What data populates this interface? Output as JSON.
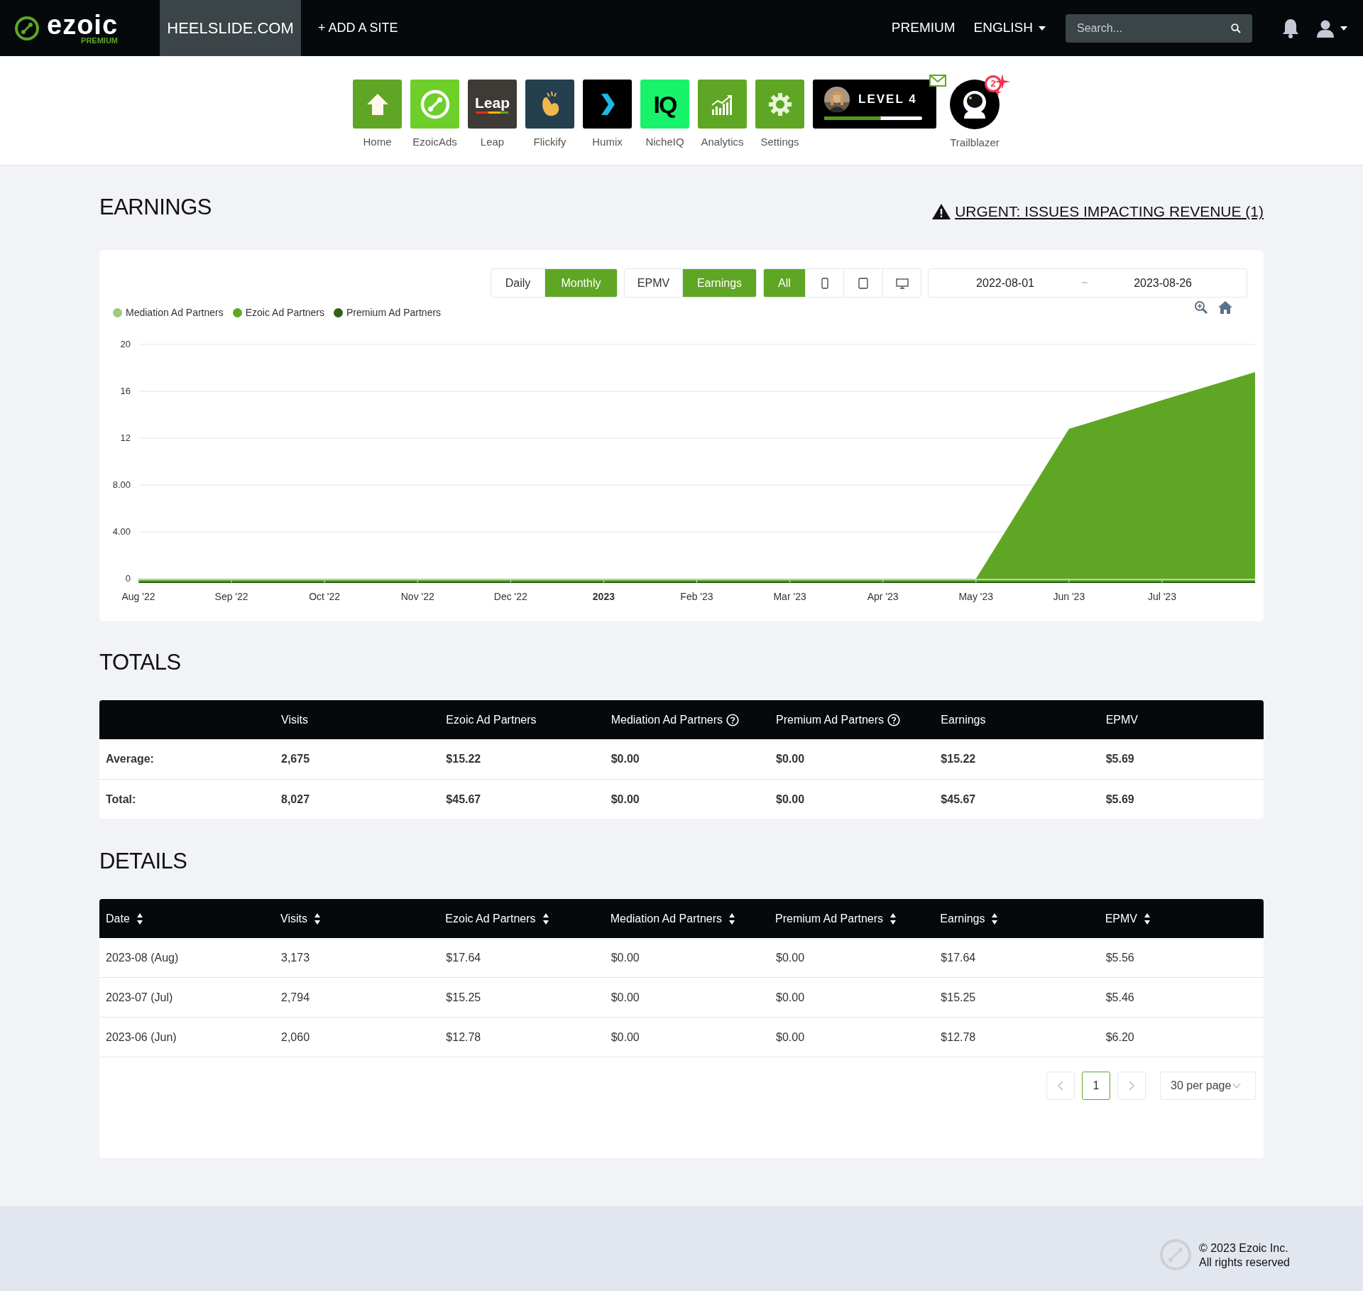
{
  "header": {
    "logo": "ezoic",
    "logo_badge": "PREMIUM",
    "site_tab": {
      "label": "HEELSLIDE.COM",
      "selected": true
    },
    "add_site": "+ ADD A SITE",
    "premium": "PREMIUM",
    "language": "ENGLISH",
    "search": {
      "placeholder": "Search..."
    }
  },
  "apps": [
    {
      "label": "Home",
      "kind": "home"
    },
    {
      "label": "EzoicAds",
      "kind": "ezoicads"
    },
    {
      "label": "Leap",
      "kind": "leap",
      "tile_text": "Leap"
    },
    {
      "label": "Flickify",
      "kind": "flickify"
    },
    {
      "label": "Humix",
      "kind": "humix"
    },
    {
      "label": "NicheIQ",
      "kind": "nicheiq",
      "tile_text": "IQ"
    },
    {
      "label": "Analytics",
      "kind": "analytics"
    },
    {
      "label": "Settings",
      "kind": "settings"
    }
  ],
  "level_card": {
    "label": "LEVEL 4",
    "level": 0.58,
    "has_mail": true
  },
  "trailblazer": {
    "label": "Trailblazer",
    "badge": "2"
  },
  "earnings": {
    "title": "EARNINGS",
    "alert": "URGENT: ISSUES IMPACTING REVENUE (1)",
    "period_toggle": [
      {
        "label": "Daily",
        "selected": false
      },
      {
        "label": "Monthly",
        "selected": true
      }
    ],
    "metric_toggle": [
      {
        "label": "EPMV",
        "selected": false
      },
      {
        "label": "Earnings",
        "selected": true
      }
    ],
    "device_toggle": [
      {
        "kind": "text",
        "label": "All",
        "selected": true
      },
      {
        "kind": "phone",
        "selected": false
      },
      {
        "kind": "tablet",
        "selected": false
      },
      {
        "kind": "desktop",
        "selected": false
      }
    ],
    "date_from": "2022-08-01",
    "date_separator": "~",
    "date_to": "2023-08-26",
    "chart_data": {
      "type": "area",
      "categories": [
        "Aug '22",
        "Sep '22",
        "Oct '22",
        "Nov '22",
        "Dec '22",
        "2023",
        "Feb '23",
        "Mar '23",
        "Apr '23",
        "May '23",
        "Jun '23",
        "Jul '23",
        null
      ],
      "ylim": [
        0,
        20
      ],
      "grid": true,
      "stacked": false,
      "yticks": [
        {
          "value": 0,
          "label": "0"
        },
        {
          "value": 4,
          "label": "4.00"
        },
        {
          "value": 8,
          "label": "8.00"
        },
        {
          "value": 12,
          "label": "12"
        },
        {
          "value": 16,
          "label": "16"
        },
        {
          "value": 20,
          "label": "20"
        }
      ],
      "series": [
        {
          "name": "Mediation Ad Partners",
          "color": "#9ccc7a",
          "values": [
            0,
            0,
            0,
            0,
            0,
            0,
            0,
            0,
            0,
            0,
            0,
            0,
            0
          ]
        },
        {
          "name": "Ezoic Ad Partners",
          "color": "#5fa624",
          "values": [
            0,
            0,
            0,
            0,
            0,
            0,
            0,
            0,
            0,
            0,
            12.78,
            15.25,
            17.64
          ]
        },
        {
          "name": "Premium Ad Partners",
          "color": "#2d6116",
          "values": [
            0,
            0,
            0,
            0,
            0,
            0,
            0,
            0,
            0,
            0,
            null,
            null,
            0
          ]
        }
      ]
    }
  },
  "totals": {
    "title": "TOTALS",
    "columns": [
      {
        "label": "Visits",
        "help": false
      },
      {
        "label": "Ezoic Ad Partners",
        "help": false
      },
      {
        "label": "Mediation Ad Partners",
        "help": true
      },
      {
        "label": "Premium Ad Partners",
        "help": true
      },
      {
        "label": "Earnings",
        "help": false
      },
      {
        "label": "EPMV",
        "help": false
      }
    ],
    "rows": [
      {
        "label": "Average:",
        "cells": [
          "2,675",
          "$15.22",
          "$0.00",
          "$0.00",
          "$15.22",
          "$5.69"
        ]
      },
      {
        "label": "Total:",
        "cells": [
          "8,027",
          "$45.67",
          "$0.00",
          "$0.00",
          "$45.67",
          "$5.69"
        ]
      }
    ]
  },
  "details": {
    "title": "DETAILS",
    "columns": [
      "Date",
      "Visits",
      "Ezoic Ad Partners",
      "Mediation Ad Partners",
      "Premium Ad Partners",
      "Earnings",
      "EPMV"
    ],
    "rows": [
      [
        "2023-08 (Aug)",
        "3,173",
        "$17.64",
        "$0.00",
        "$0.00",
        "$17.64",
        "$5.56"
      ],
      [
        "2023-07 (Jul)",
        "2,794",
        "$15.25",
        "$0.00",
        "$0.00",
        "$15.25",
        "$5.46"
      ],
      [
        "2023-06 (Jun)",
        "2,060",
        "$12.78",
        "$0.00",
        "$0.00",
        "$12.78",
        "$6.20"
      ]
    ],
    "pagination": {
      "pages": [
        {
          "label": "1",
          "selected": true
        }
      ],
      "per_page": "30 per page"
    }
  },
  "footer": {
    "copyright": "© 2023 Ezoic Inc.",
    "rights": "All rights reserved"
  }
}
